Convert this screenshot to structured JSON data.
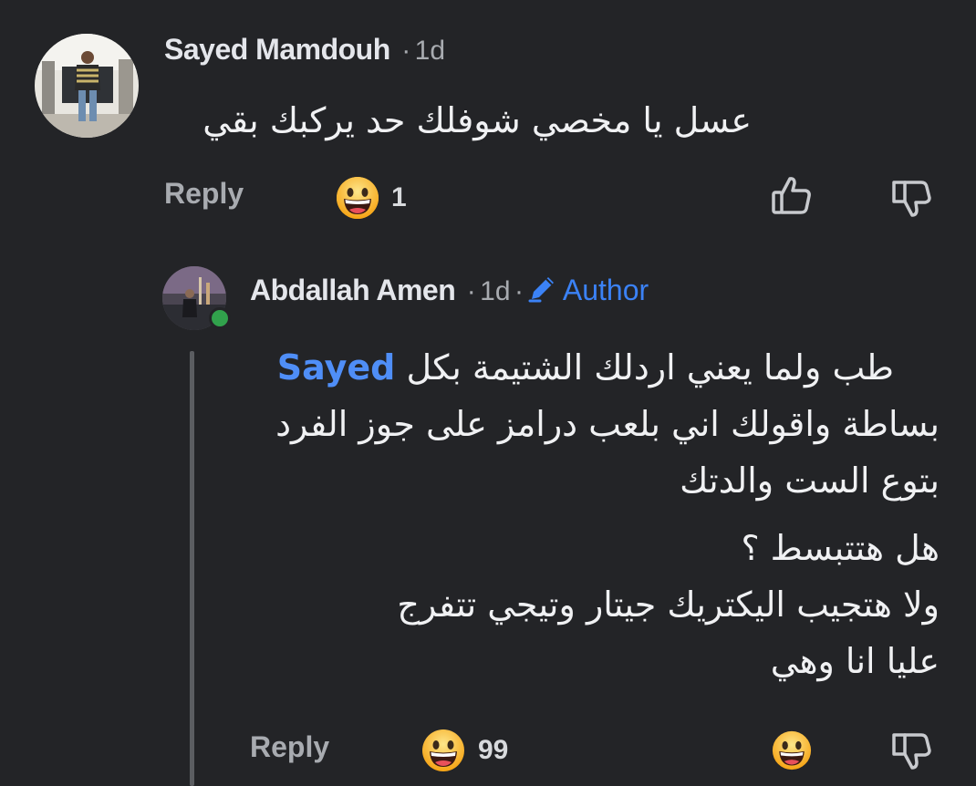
{
  "comment": {
    "author": "Sayed Mamdouh",
    "separator": "·",
    "time": "1d",
    "text": "عسل يا مخصي شوفلك حد يركبك بقي",
    "reply_label": "Reply",
    "reaction_count": "1",
    "reaction_icon": "grinning-face-emoji"
  },
  "reply": {
    "author": "Abdallah Amen",
    "separator1": "·",
    "time": "1d",
    "separator2": "·",
    "badge": "Author",
    "line1_mention": "Sayed",
    "line1_text": "طب ولما يعني اردلك الشتيمة بكل",
    "line2": "بساطة واقولك اني بلعب درامز على جوز الفرد",
    "line3": "بتوع الست والدتك",
    "line4": "هل هتتبسط ؟",
    "line5": "ولا هتجيب اليكتريك جيتار وتيجي تتفرج",
    "line6": "عليا انا وهي",
    "reply_label": "Reply",
    "reaction_count": "99",
    "online_color": "#31a24c"
  },
  "colors": {
    "background": "#232427",
    "accent": "#3b82f6",
    "muted": "#a8abb0"
  }
}
